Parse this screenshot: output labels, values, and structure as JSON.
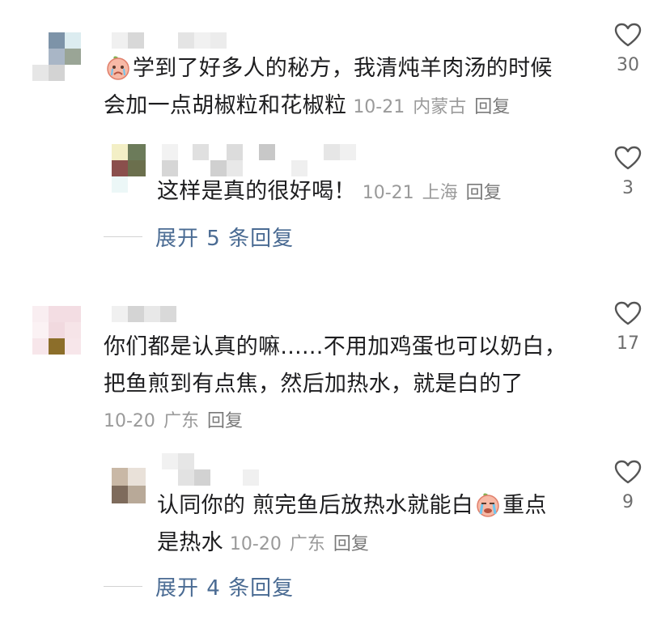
{
  "colors": {
    "text": "#1d1d1f",
    "meta": "#9a9a9a",
    "link": "#4a6b93",
    "icon": "#555555"
  },
  "comments": [
    {
      "emoji": "crying-peach-emoji",
      "text": "学到了好多人的秘方，我清炖羊肉汤的时候会加一点胡椒粒和花椒粒",
      "line1": "学到了好多人的秘方，我清炖羊肉汤的时候",
      "line2": "会加一点胡椒粒和花椒粒",
      "date": "10-21",
      "location": "内蒙古",
      "reply_label": "回复",
      "likes": "30",
      "like_icon": "heart-outline-icon",
      "replies": [
        {
          "text": "这样是真的很好喝！",
          "date": "10-21",
          "location": "上海",
          "reply_label": "回复",
          "likes": "3",
          "like_icon": "heart-outline-icon"
        }
      ],
      "expand_label": "展开 5 条回复"
    },
    {
      "text": "你们都是认真的嘛......不用加鸡蛋也可以奶白，把鱼煎到有点焦，然后加热水，就是白的了",
      "line1": "你们都是认真的嘛......不用加鸡蛋也可以奶白，",
      "line2": "把鱼煎到有点焦，然后加热水，就是白的了",
      "date": "10-20",
      "location": "广东",
      "reply_label": "回复",
      "likes": "17",
      "like_icon": "heart-outline-icon",
      "replies": [
        {
          "text_before_emoji": "认同你的 煎完鱼后放热水就能白",
          "emoji": "crying-peach-emoji",
          "text_after_emoji": "重点",
          "line2": "是热水",
          "date": "10-20",
          "location": "广东",
          "reply_label": "回复",
          "likes": "9",
          "like_icon": "heart-outline-icon"
        }
      ],
      "expand_label": "展开 4 条回复"
    }
  ]
}
